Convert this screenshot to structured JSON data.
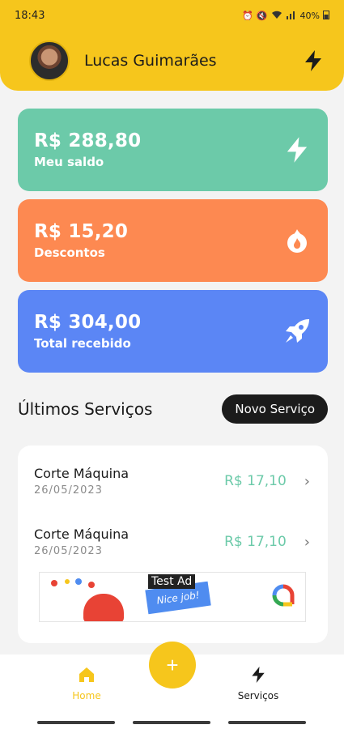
{
  "status_bar": {
    "time": "18:43",
    "battery": "40%"
  },
  "header": {
    "user_name": "Lucas Guimarães",
    "action_icon": "bolt-icon"
  },
  "cards": [
    {
      "amount": "R$ 288,80",
      "label": "Meu saldo",
      "color": "#6ccaa9",
      "icon": "bolt-icon"
    },
    {
      "amount": "R$ 15,20",
      "label": "Descontos",
      "color": "#fd8951",
      "icon": "flame-icon"
    },
    {
      "amount": "R$ 304,00",
      "label": "Total recebido",
      "color": "#5b86f5",
      "icon": "rocket-icon"
    }
  ],
  "services_section": {
    "title": "Últimos Serviços",
    "new_button": "Novo Serviço",
    "items": [
      {
        "name": "Corte Máquina",
        "date": "26/05/2023",
        "price": "R$ 17,10"
      },
      {
        "name": "Corte Máquina",
        "date": "26/05/2023",
        "price": "R$ 17,10"
      }
    ]
  },
  "ad": {
    "label": "Test Ad",
    "tagline": "Nice job!"
  },
  "bottom_nav": {
    "home": "Home",
    "services": "Serviços",
    "fab_symbol": "+"
  },
  "colors": {
    "primary": "#f6c61c",
    "accent_green": "#6ccaa9",
    "dark": "#1b1b1b"
  }
}
